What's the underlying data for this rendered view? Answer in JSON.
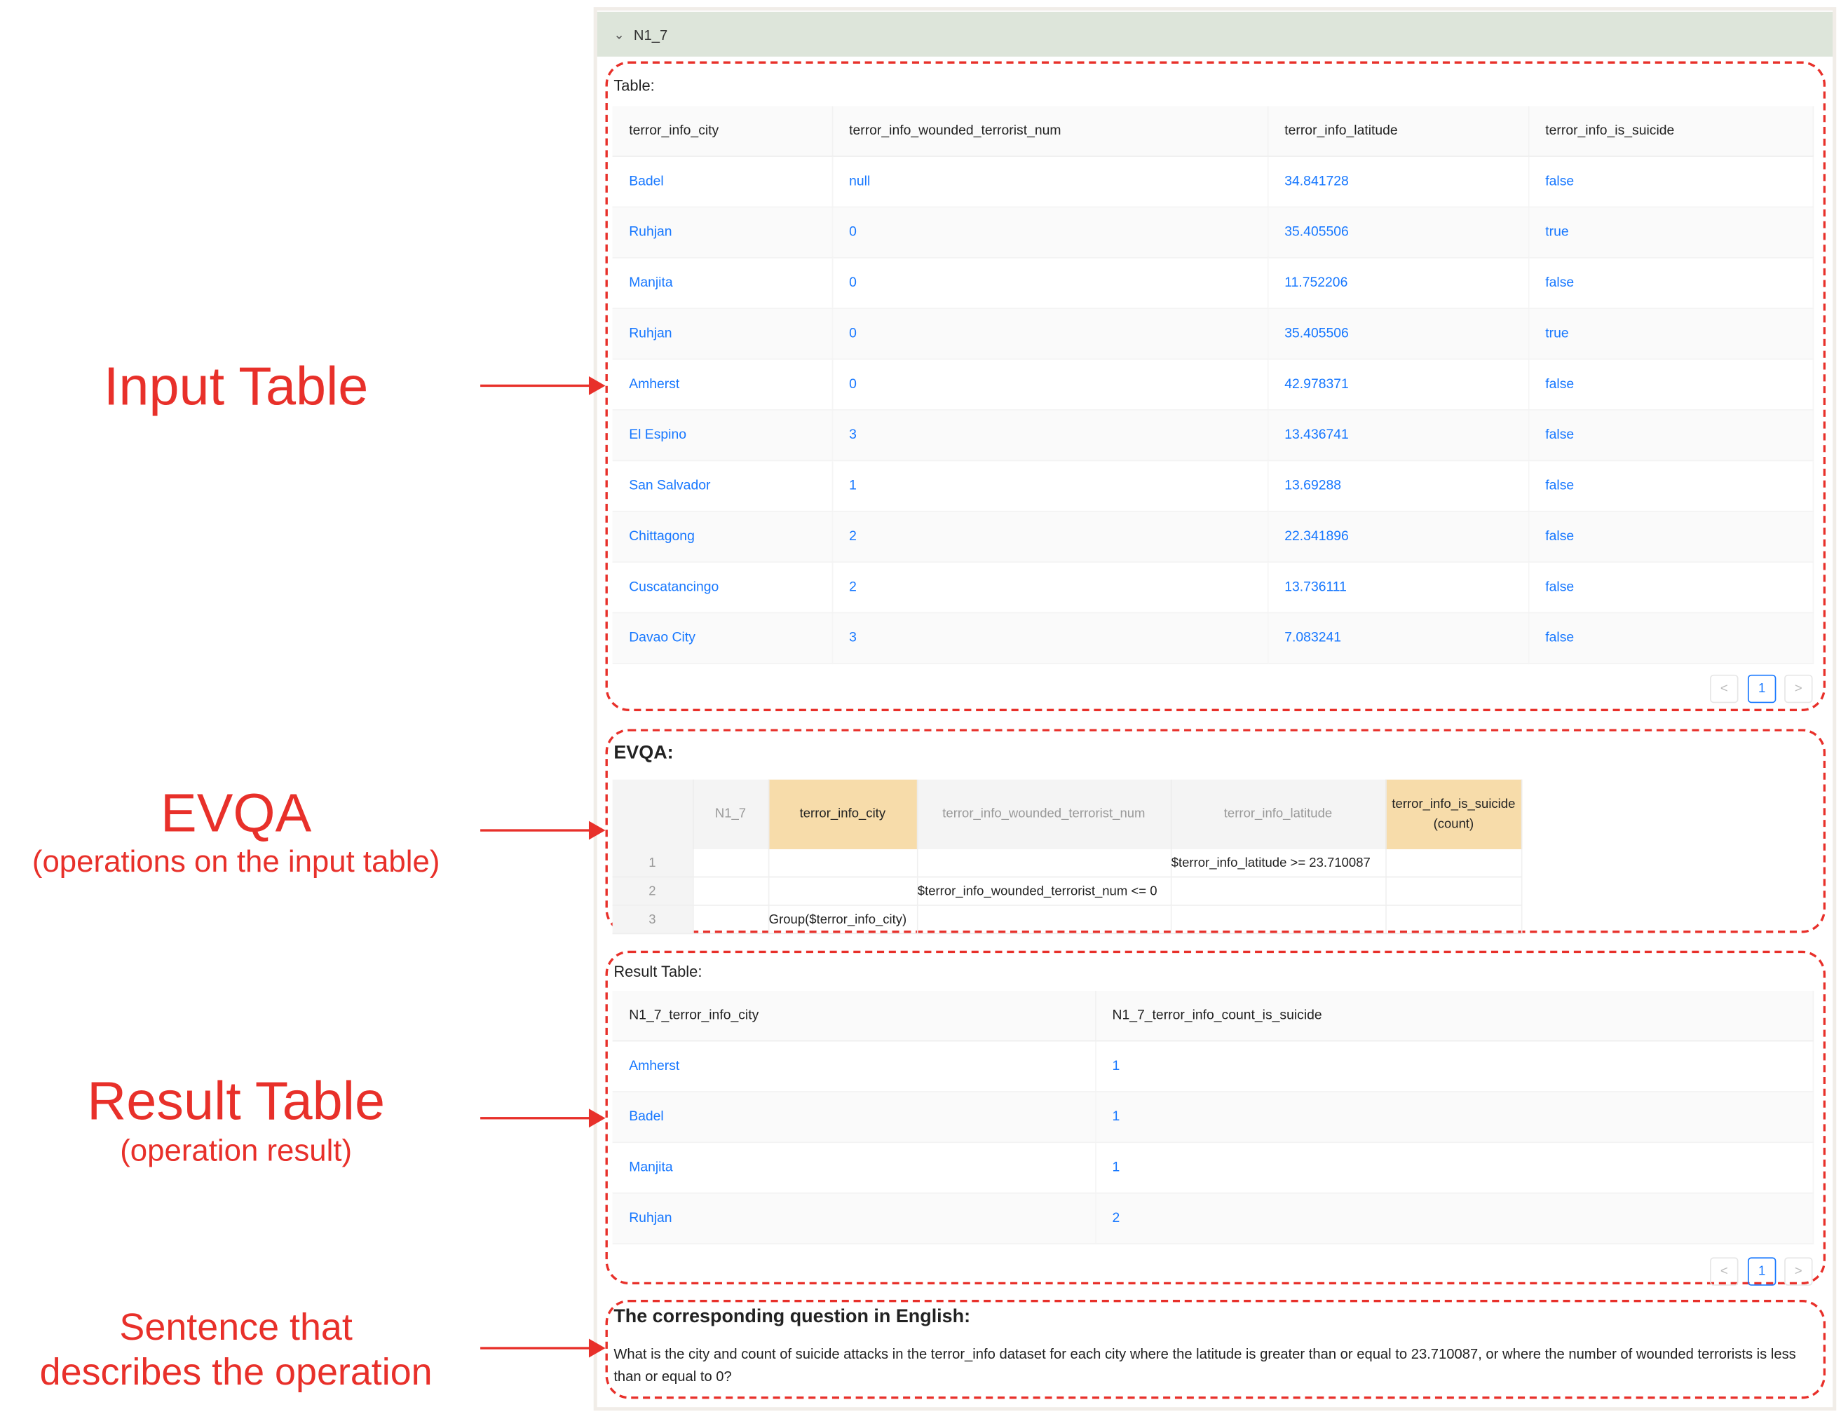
{
  "panel": {
    "title": "N1_7",
    "chevron": "chevron-down-icon"
  },
  "input_table": {
    "label": "Table:",
    "columns": [
      "terror_info_city",
      "terror_info_wounded_terrorist_num",
      "terror_info_latitude",
      "terror_info_is_suicide"
    ],
    "rows": [
      [
        "Badel",
        "null",
        "34.841728",
        "false"
      ],
      [
        "Ruhjan",
        "0",
        "35.405506",
        "true"
      ],
      [
        "Manjita",
        "0",
        "11.752206",
        "false"
      ],
      [
        "Ruhjan",
        "0",
        "35.405506",
        "true"
      ],
      [
        "Amherst",
        "0",
        "42.978371",
        "false"
      ],
      [
        "El Espino",
        "3",
        "13.436741",
        "false"
      ],
      [
        "San Salvador",
        "1",
        "13.69288",
        "false"
      ],
      [
        "Chittagong",
        "2",
        "22.341896",
        "false"
      ],
      [
        "Cuscatancingo",
        "2",
        "13.736111",
        "false"
      ],
      [
        "Davao City",
        "3",
        "7.083241",
        "false"
      ]
    ],
    "pagination": {
      "prev": "<",
      "page": "1",
      "next": ">"
    }
  },
  "evqa": {
    "label": "EVQA:",
    "columns": [
      "",
      "N1_7",
      "terror_info_city",
      "terror_info_wounded_terrorist_num",
      "terror_info_latitude",
      "terror_info_is_suicide (count)"
    ],
    "rows": [
      [
        "1",
        "",
        "",
        "",
        "$terror_info_latitude >= 23.710087",
        ""
      ],
      [
        "2",
        "",
        "",
        "$terror_info_wounded_terrorist_num <= 0",
        "",
        ""
      ],
      [
        "3",
        "",
        "Group($terror_info_city)",
        "",
        "",
        ""
      ]
    ]
  },
  "result_table": {
    "label": "Result Table:",
    "columns": [
      "N1_7_terror_info_city",
      "N1_7_terror_info_count_is_suicide"
    ],
    "rows": [
      [
        "Amherst",
        "1"
      ],
      [
        "Badel",
        "1"
      ],
      [
        "Manjita",
        "1"
      ],
      [
        "Ruhjan",
        "2"
      ]
    ],
    "pagination": {
      "prev": "<",
      "page": "1",
      "next": ">"
    }
  },
  "question": {
    "label": "The corresponding question in English:",
    "text": "What is the city and count of suicide attacks in the terror_info dataset for each city where the latitude is greater than or equal to 23.710087, or where the number of wounded terrorists is less than or equal to 0?"
  },
  "annotations": {
    "input": "Input Table",
    "evqa": "EVQA",
    "evqa_sub": "(operations on the input table)",
    "result": "Result Table",
    "result_sub": "(operation result)",
    "sentence_1": "Sentence that",
    "sentence_2": "describes the operation",
    "color": "#e8302a"
  }
}
